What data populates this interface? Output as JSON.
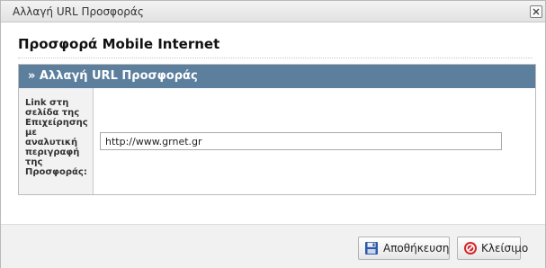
{
  "window": {
    "title": "Αλλαγή URL Προσφοράς",
    "close_icon": "close-icon"
  },
  "main": {
    "title": "Προσφορά Mobile Internet",
    "form": {
      "header": "» Αλλαγή URL Προσφοράς",
      "field_label": "Link στη σελίδα της Επιχείρησης με αναλυτική περιγραφή της Προσφοράς:",
      "field_value": "http://www.grnet.gr"
    }
  },
  "footer": {
    "save_label": "Αποθήκευση",
    "save_icon": "floppy-disk-icon",
    "close_label": "Κλείσιμο",
    "close_icon": "cancel-icon"
  },
  "colors": {
    "header_bg": "#5d7f9e",
    "label_bg": "#f2f2f2",
    "footer_bg": "#f1f1f1",
    "cancel_red": "#d3262a",
    "save_blue": "#2d5aa8"
  }
}
